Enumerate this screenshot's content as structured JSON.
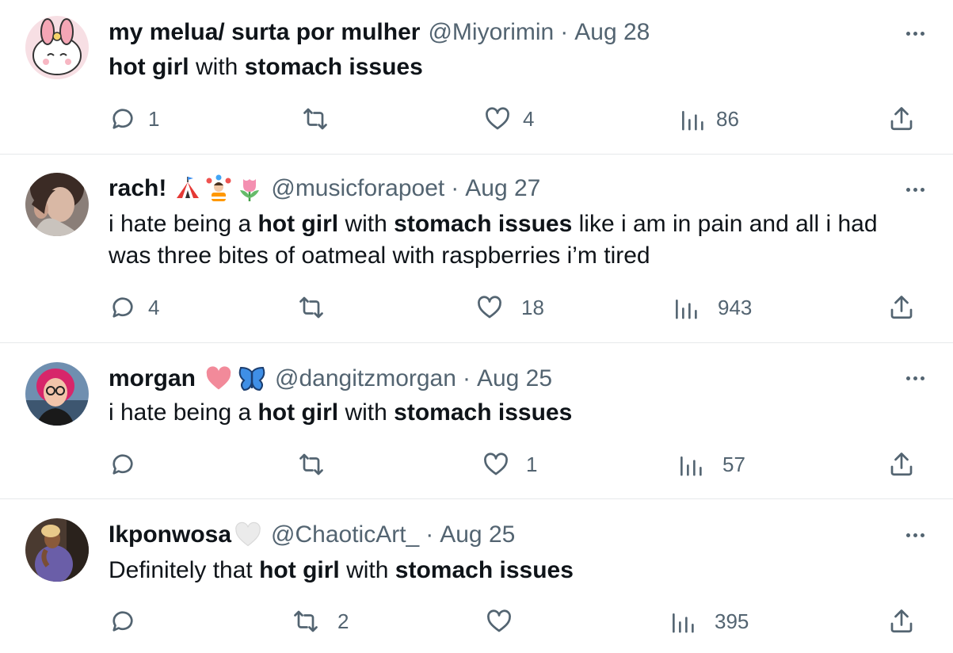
{
  "tweets": [
    {
      "name": "my melua/ surta por mulher",
      "handle": "@Miyorimin",
      "sep": "·",
      "date": "Aug 28",
      "body": [
        {
          "t": "hot girl",
          "b": true
        },
        {
          "t": " with ",
          "b": false
        },
        {
          "t": "stomach issues",
          "b": true
        }
      ],
      "replies": "1",
      "retweets": "",
      "likes": "4",
      "views": "86"
    },
    {
      "name": "rach!",
      "handle": "@musicforapoet",
      "sep": "·",
      "date": "Aug 27",
      "body": [
        {
          "t": "i hate being a ",
          "b": false
        },
        {
          "t": "hot girl",
          "b": true
        },
        {
          "t": " with ",
          "b": false
        },
        {
          "t": "stomach issues",
          "b": true
        },
        {
          "t": " like i am in pain and all i had was three bites of oatmeal with raspberries i’m tired",
          "b": false
        }
      ],
      "replies": "4",
      "retweets": "",
      "likes": "18",
      "views": "943"
    },
    {
      "name": "morgan",
      "handle": "@dangitzmorgan",
      "sep": "·",
      "date": "Aug 25",
      "body": [
        {
          "t": "i hate being a ",
          "b": false
        },
        {
          "t": "hot girl",
          "b": true
        },
        {
          "t": " with ",
          "b": false
        },
        {
          "t": "stomach issues",
          "b": true
        }
      ],
      "replies": "",
      "retweets": "",
      "likes": "1",
      "views": "57"
    },
    {
      "name": "Ikponwosa",
      "handle": "@ChaoticArt_",
      "sep": "·",
      "date": "Aug 25",
      "body": [
        {
          "t": "Definitely that ",
          "b": false
        },
        {
          "t": "hot girl",
          "b": true
        },
        {
          "t": " with ",
          "b": false
        },
        {
          "t": "stomach issues",
          "b": true
        }
      ],
      "replies": "",
      "retweets": "2",
      "likes": "",
      "views": "395"
    }
  ],
  "colors": {
    "text": "#0f1419",
    "muted": "#536471",
    "divider": "#e6e9eb"
  },
  "icons": [
    "reply-icon",
    "retweet-icon",
    "like-icon",
    "views-icon",
    "share-icon",
    "more-icon"
  ]
}
